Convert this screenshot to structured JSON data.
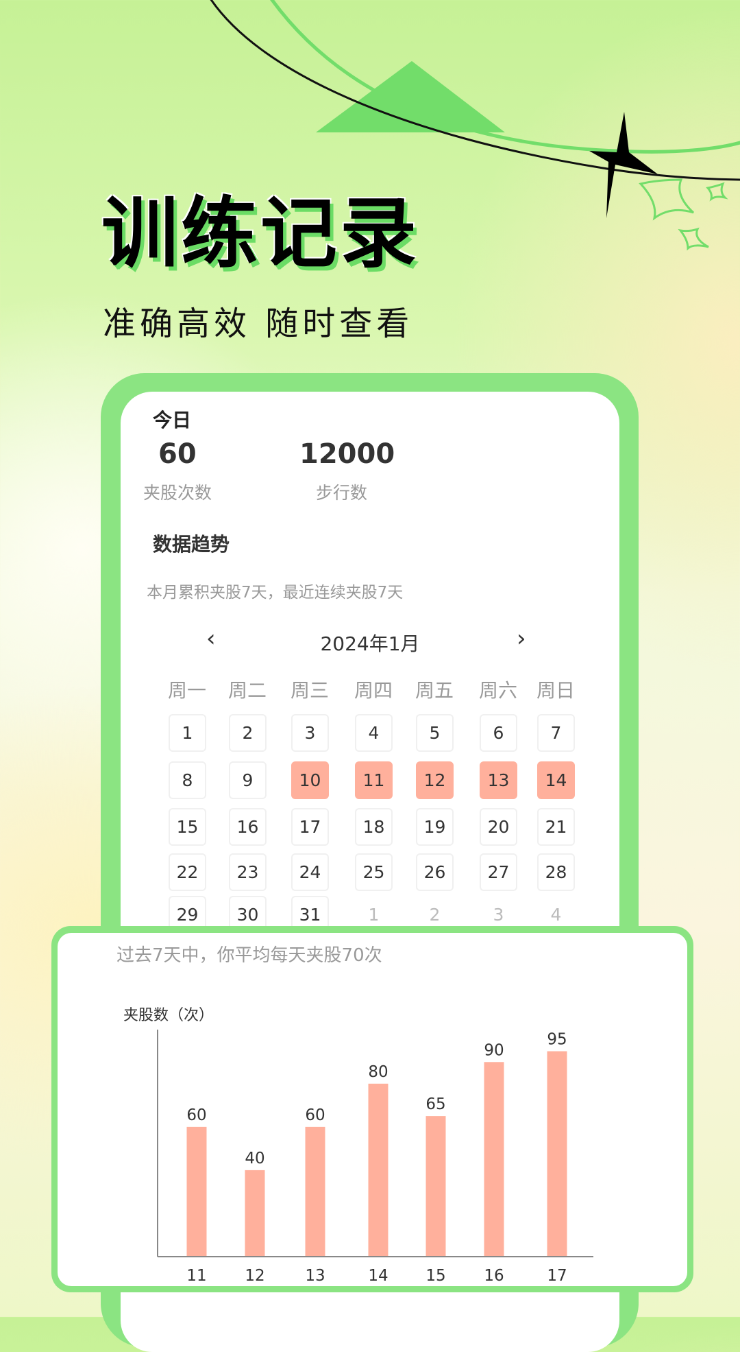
{
  "hero": {
    "title": "训练记录",
    "subtitle": "准确高效  随时查看"
  },
  "today": {
    "heading": "今日",
    "stats": [
      {
        "value": "60",
        "label": "夹股次数"
      },
      {
        "value": "12000",
        "label": "步行数"
      }
    ]
  },
  "trend": {
    "heading": "数据趋势",
    "summary": "本月累积夹股7天，最近连续夹股7天"
  },
  "calendar": {
    "title": "2024年1月",
    "prev_icon": "chevron-left-icon",
    "next_icon": "chevron-right-icon",
    "weekdays": [
      "周一",
      "周二",
      "周三",
      "周四",
      "周五",
      "周六",
      "周日"
    ],
    "days": [
      "1",
      "2",
      "3",
      "4",
      "5",
      "6",
      "7",
      "8",
      "9",
      "10",
      "11",
      "12",
      "13",
      "14",
      "15",
      "16",
      "17",
      "18",
      "19",
      "20",
      "21",
      "22",
      "23",
      "24",
      "25",
      "26",
      "27",
      "28",
      "29",
      "30",
      "31",
      "1",
      "2",
      "3",
      "4"
    ],
    "highlighted": [
      "10",
      "11",
      "12",
      "13",
      "14"
    ],
    "highlight_color": "#ffb09c"
  },
  "chart_card": {
    "summary": "过去7天中，你平均每天夹股70次"
  },
  "chart_data": {
    "type": "bar",
    "title": "",
    "ylabel": "夹股数（次）",
    "xlabel": "",
    "categories": [
      "11",
      "12",
      "13",
      "14",
      "15",
      "16",
      "17"
    ],
    "values": [
      60,
      40,
      60,
      80,
      65,
      90,
      95
    ],
    "ylim": [
      0,
      105
    ],
    "bar_color": "#ffb09c",
    "grid": false
  },
  "colors": {
    "accent": "#8be482",
    "bar": "#ffb09c"
  }
}
